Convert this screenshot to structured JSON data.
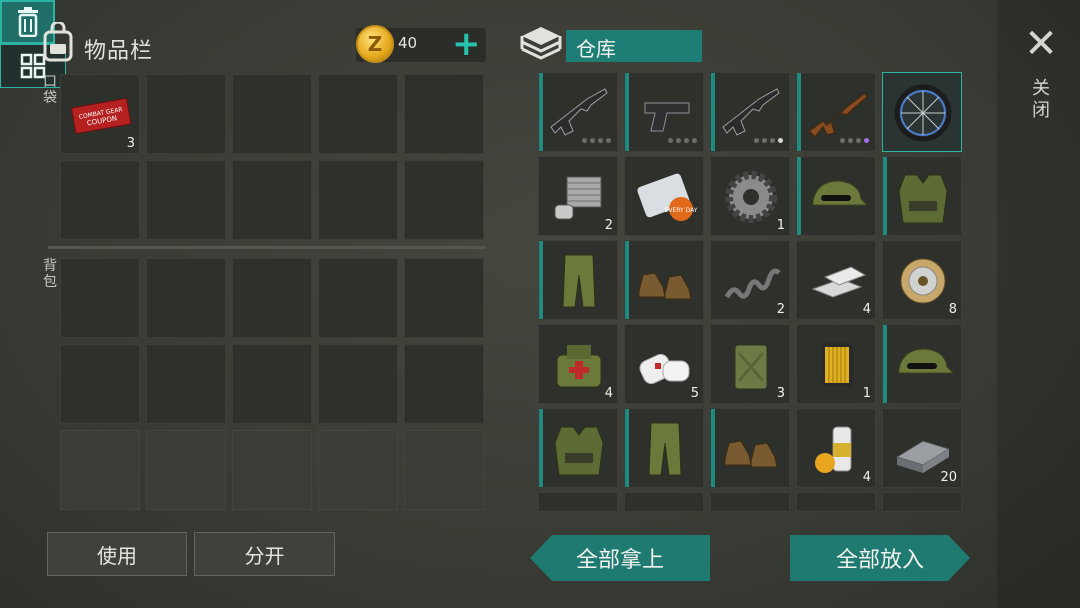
{
  "inventory": {
    "title": "物品栏",
    "coins": "40",
    "coin_symbol": "Z",
    "pocket_label": "口袋",
    "backpack_label": "背包",
    "pocket_items": [
      {
        "name": "combat-gear-coupon",
        "text": "COMBAT GEAR COUPON",
        "qty": "3"
      }
    ]
  },
  "warehouse": {
    "title": "仓库",
    "rows": [
      [
        {
          "name": "m16-rifle",
          "qty": "",
          "dots": "gggg"
        },
        {
          "name": "pistol",
          "qty": "",
          "dots": "gggg"
        },
        {
          "name": "m16-rifle",
          "qty": "",
          "dots": "gggw"
        },
        {
          "name": "ak-rifle",
          "qty": "",
          "dots": "gggp"
        },
        {
          "name": "bicycle-wheel",
          "qty": "",
          "selected": true
        }
      ],
      [
        {
          "name": "engine-cylinder",
          "qty": "2"
        },
        {
          "name": "magazine-roll",
          "qty": "",
          "badge": "EVERY DAY"
        },
        {
          "name": "gear",
          "qty": "1"
        },
        {
          "name": "military-cap",
          "qty": ""
        },
        {
          "name": "camo-vest",
          "qty": ""
        }
      ],
      [
        {
          "name": "camo-pants",
          "qty": ""
        },
        {
          "name": "boots",
          "qty": ""
        },
        {
          "name": "spring",
          "qty": "2"
        },
        {
          "name": "metal-bars",
          "qty": "4"
        },
        {
          "name": "wire-spool",
          "qty": "8"
        }
      ],
      [
        {
          "name": "medic-bag",
          "qty": "4"
        },
        {
          "name": "bandages",
          "qty": "5"
        },
        {
          "name": "jerrycan",
          "qty": "3"
        },
        {
          "name": "oil-filter",
          "qty": "1"
        },
        {
          "name": "military-cap",
          "qty": ""
        }
      ],
      [
        {
          "name": "camo-vest",
          "qty": ""
        },
        {
          "name": "camo-pants",
          "qty": ""
        },
        {
          "name": "boots",
          "qty": ""
        },
        {
          "name": "spray-paint",
          "qty": "4"
        },
        {
          "name": "steel-ingot",
          "qty": "20"
        }
      ]
    ]
  },
  "side": {
    "close_label": "关闭"
  },
  "buttons": {
    "use": "使用",
    "split": "分开",
    "take_all": "全部拿上",
    "put_all": "全部放入"
  },
  "colors": {
    "accent": "#1f7a71",
    "accent_light": "#2bb3a4",
    "rarity_purple": "#a570e6"
  }
}
